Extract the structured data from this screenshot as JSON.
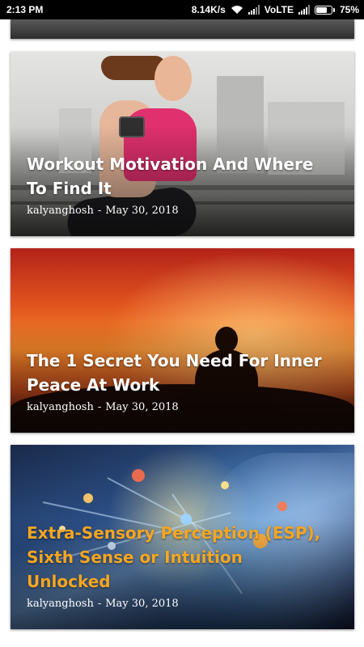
{
  "status_bar": {
    "time": "2:13 PM",
    "network_speed": "8.14K/s",
    "network_type": "VoLTE",
    "battery_percent": "75%",
    "battery_level": 0.75,
    "icons": [
      "wifi-icon",
      "signal-icon",
      "signal-icon",
      "battery-icon"
    ]
  },
  "feed": {
    "posts": [
      {
        "title": "Workout Motivation And Where To Find It",
        "author": "kalyanghosh",
        "separator": "-",
        "date": "May 30, 2018",
        "title_color": "#ffffff"
      },
      {
        "title": "The 1 Secret You Need For Inner Peace At Work",
        "author": "kalyanghosh",
        "separator": "-",
        "date": "May 30, 2018",
        "title_color": "#ffffff"
      },
      {
        "title": "Extra-Sensory Perception (ESP), Sixth Sense or Intuition Unlocked",
        "author": "kalyanghosh",
        "separator": "-",
        "date": "May 30, 2018",
        "title_color": "#f5a623"
      }
    ]
  }
}
